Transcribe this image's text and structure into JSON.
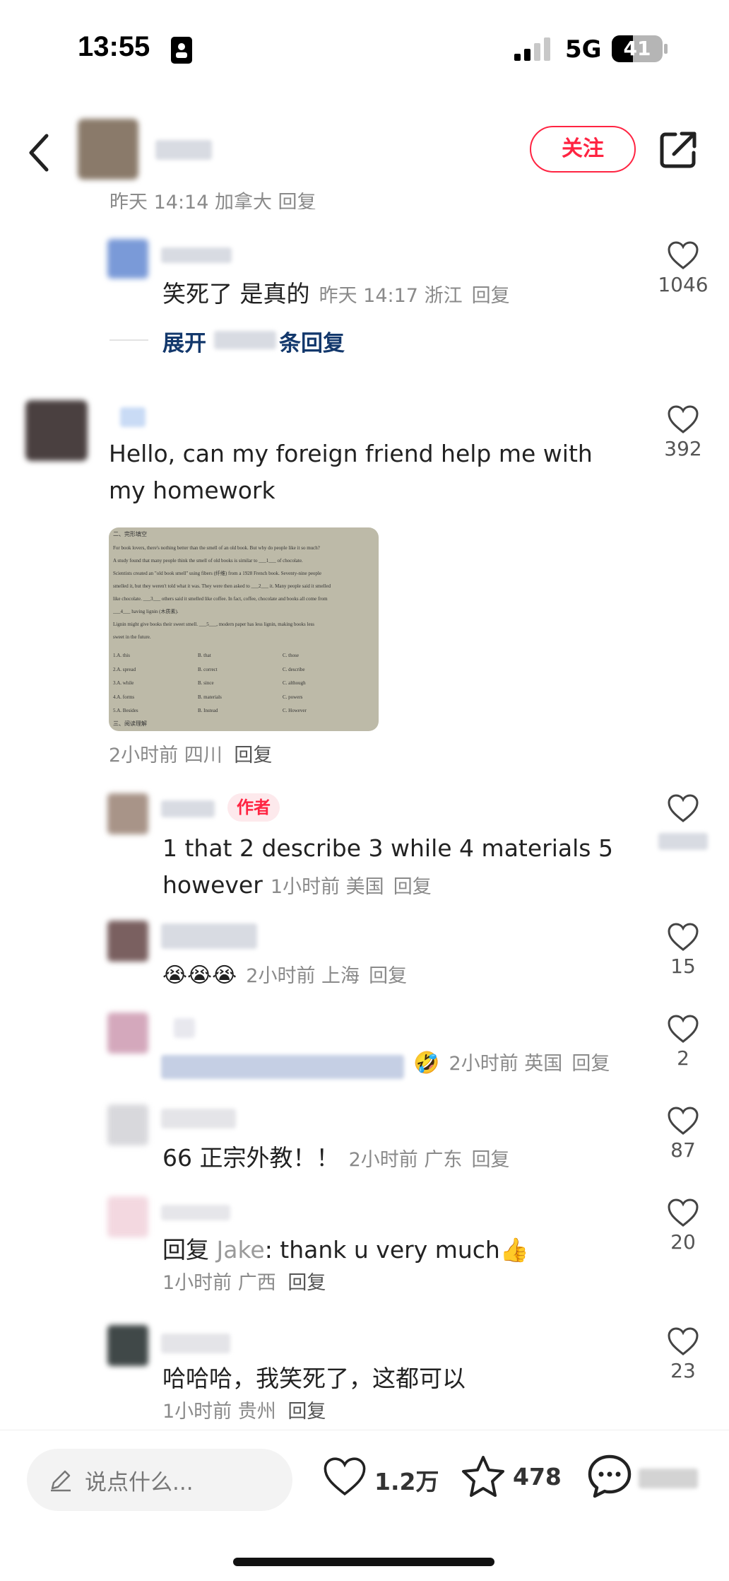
{
  "status": {
    "time": "13:55",
    "network": "5G",
    "battery": "41"
  },
  "header": {
    "follow_label": "关注"
  },
  "partial_meta": "昨天 14:14 加拿大 回复",
  "expand": {
    "prefix": "展开",
    "suffix": "条回复"
  },
  "reply_label": "回复",
  "author_badge": "作者",
  "comments": [
    {
      "text": "笑死了 是真的",
      "meta": "昨天 14:17 浙江",
      "likes": "1046"
    },
    {
      "text": "Hello, can my foreign friend help me with my homework",
      "meta": "2小时前 四川",
      "likes": "392"
    },
    {
      "text": "1 that 2 describe 3 while 4 materials 5 however",
      "meta": "1小时前 美国",
      "likes": ""
    },
    {
      "text": "😭😭😭",
      "meta": "2小时前 上海",
      "likes": "15"
    },
    {
      "text": "🤣",
      "meta": "2小时前 英国",
      "likes": "2"
    },
    {
      "text": "66 正宗外教！！",
      "meta": "2小时前 广东",
      "likes": "87"
    },
    {
      "text_prefix": "回复 ",
      "mention": "Jake",
      "text": ": thank u very much👍",
      "meta": "1小时前 广西",
      "likes": "20"
    },
    {
      "text": "哈哈哈，我笑死了，这都可以",
      "meta": "1小时前 贵州",
      "likes": "23"
    }
  ],
  "homework_image": {
    "title": "二、完形填空",
    "lines": [
      "For book lovers, there's nothing better than the smell of an old book. But why do people like it so much?",
      "A study found that many people think the smell of old books is similar to ___1___ of chocolate.",
      "Scientists created an \"old book smell\" using fibers (纤维) from a 1928 French book. Seventy-nine people",
      "smelled it, but they weren't told what it was. They were then asked to ___2___ it. Many people said it smelled",
      "like chocolate. ___3___ others said it smelled like coffee. In fact, coffee, chocolate and books all come from",
      "___4___ having lignin (木质素).",
      "Lignin might give books their sweet smell. ___5___, modern paper has less lignin, making books less",
      "sweet in the future."
    ],
    "options": [
      [
        "1.A. this",
        "B. that",
        "C. those"
      ],
      [
        "2.A. spread",
        "B. correct",
        "C. describe"
      ],
      [
        "3.A. while",
        "B. since",
        "C. although"
      ],
      [
        "4.A. forms",
        "B. materials",
        "C. powers"
      ],
      [
        "5.A. Besides",
        "B. Instead",
        "C. However"
      ]
    ],
    "footer": "三、阅读理解"
  },
  "bottom_bar": {
    "input_placeholder": "说点什么...",
    "likes": "1.2万",
    "favorites": "478"
  }
}
